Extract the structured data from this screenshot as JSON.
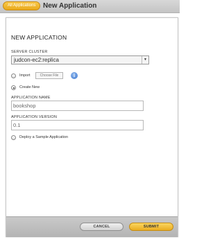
{
  "header": {
    "breadcrumb_label": "All Applications",
    "title": "New Application"
  },
  "dialog": {
    "title": "NEW APPLICATION",
    "server_cluster": {
      "label": "SERVER CLUSTER",
      "selected": "judcon-ec2:replica"
    },
    "source": {
      "import_label": "Import",
      "choose_file_label": "Choose File",
      "create_new_label": "Create New",
      "selected": "Create New"
    },
    "app_name": {
      "label": "APPLICATION NAME",
      "value": "bookshop"
    },
    "app_version": {
      "label": "APPLICATION VERSION",
      "value": "0.1"
    },
    "sample": {
      "label": "Deploy a Sample Application",
      "checked": false
    },
    "buttons": {
      "cancel": "CANCEL",
      "submit": "SUBMIT"
    }
  },
  "icons": {
    "info": "info-icon",
    "dropdown": "chevron-down-icon"
  },
  "colors": {
    "accent": "#f0b32c",
    "info_blue": "#3f78cf"
  }
}
